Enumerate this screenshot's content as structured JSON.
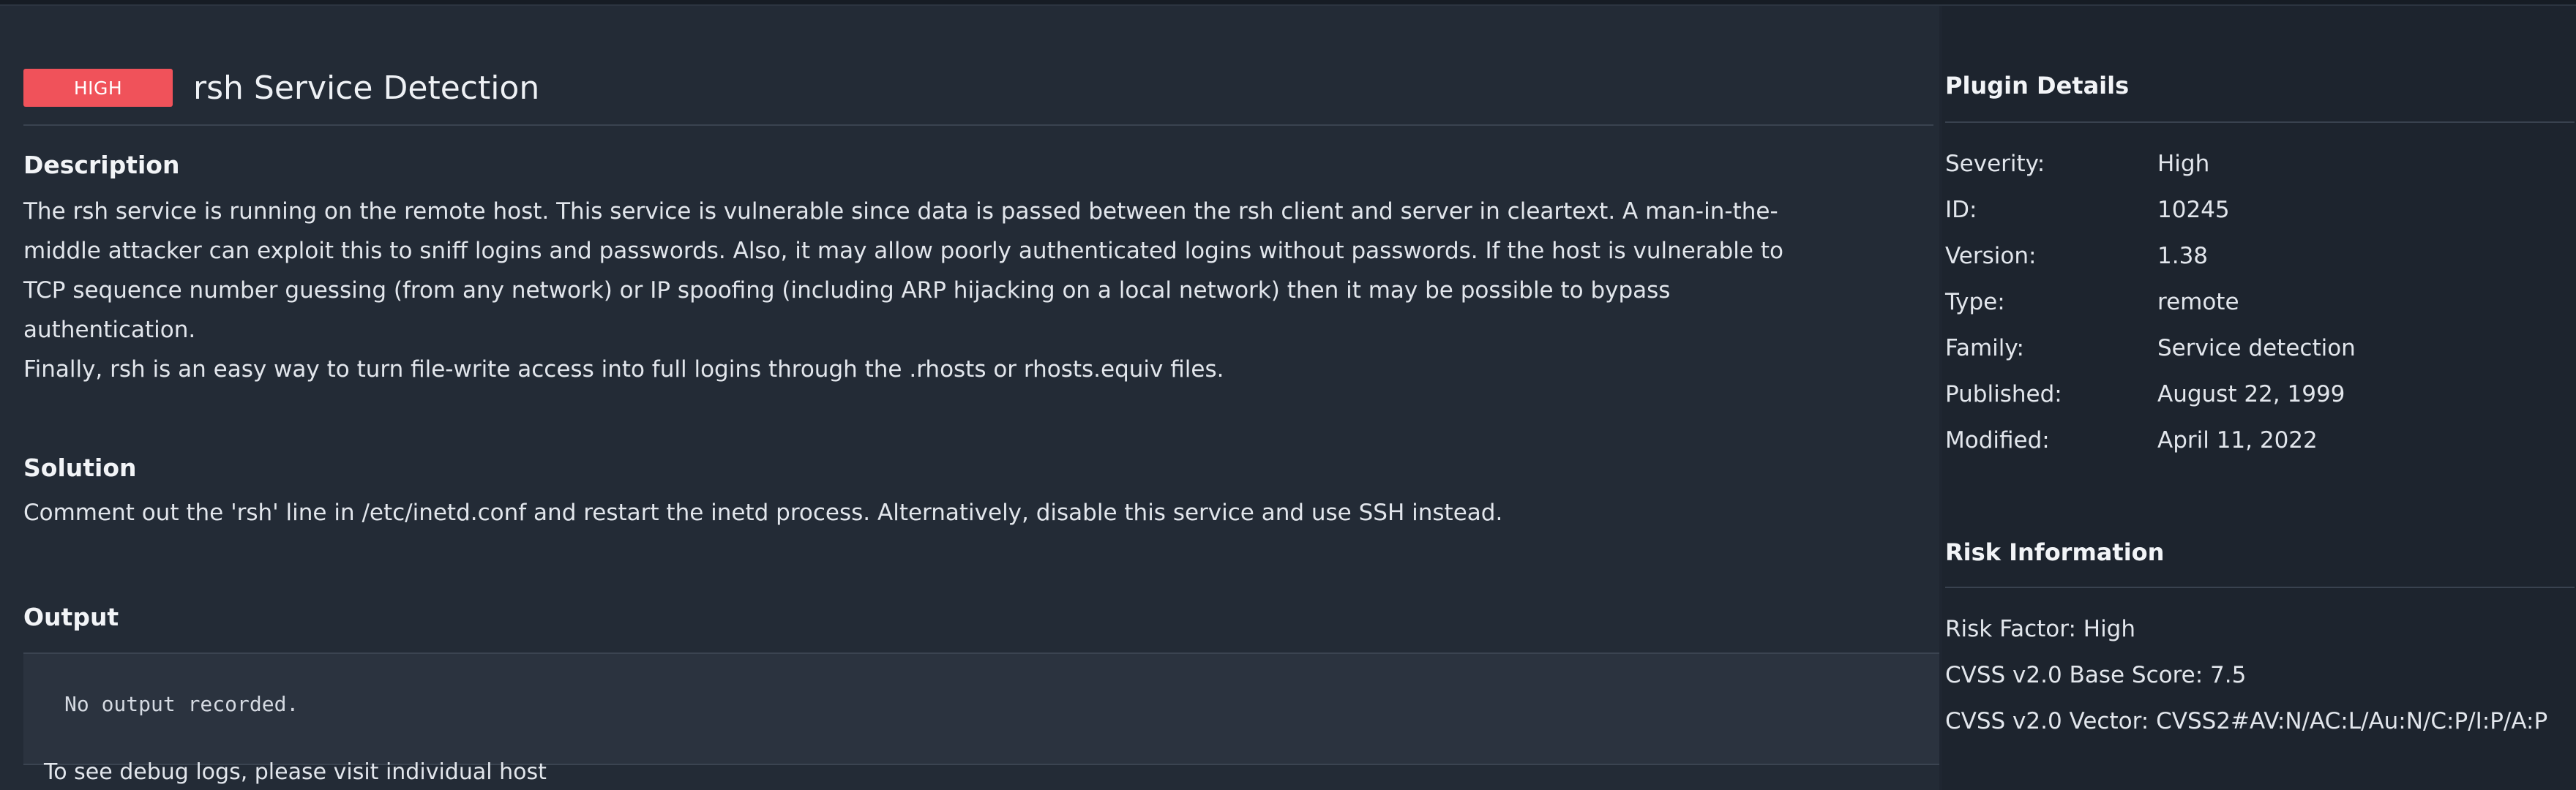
{
  "plugin": {
    "severity_badge": "HIGH",
    "title": "rsh Service Detection"
  },
  "description": {
    "heading": "Description",
    "paragraph": "The rsh service is running on the remote host. This service is vulnerable since data is passed between the rsh client and server in cleartext. A man-in-the-middle attacker can exploit this to sniff logins and passwords. Also, it may allow poorly authenticated logins without passwords. If the host is vulnerable to TCP sequence number guessing (from any network) or IP spoofing (including ARP hijacking on a local network) then it may be possible to bypass authentication.",
    "paragraph2": "Finally, rsh is an easy way to turn file-write access into full logins through the .rhosts or rhosts.equiv files."
  },
  "solution": {
    "heading": "Solution",
    "text": "Comment out the 'rsh' line in /etc/inetd.conf and restart the inetd process. Alternatively, disable this service and use SSH instead."
  },
  "output": {
    "heading": "Output",
    "text": "No output recorded.",
    "debug_note": "To see debug logs, please visit individual host"
  },
  "plugin_details": {
    "heading": "Plugin Details",
    "rows": [
      {
        "key": "Severity:",
        "value": "High"
      },
      {
        "key": "ID:",
        "value": "10245"
      },
      {
        "key": "Version:",
        "value": "1.38"
      },
      {
        "key": "Type:",
        "value": "remote"
      },
      {
        "key": "Family:",
        "value": "Service detection"
      },
      {
        "key": "Published:",
        "value": "August 22, 1999"
      },
      {
        "key": "Modified:",
        "value": "April 11, 2022"
      }
    ]
  },
  "risk_information": {
    "heading": "Risk Information",
    "risk_factor": "Risk Factor: High",
    "cvss_base_score": "CVSS v2.0 Base Score: 7.5",
    "cvss_vector": "CVSS v2.0 Vector: CVSS2#AV:N/AC:L/Au:N/C:P/I:P/A:P"
  },
  "colors": {
    "severity_high": "#f0525a",
    "background": "#1f2631",
    "panel": "#232b36"
  }
}
